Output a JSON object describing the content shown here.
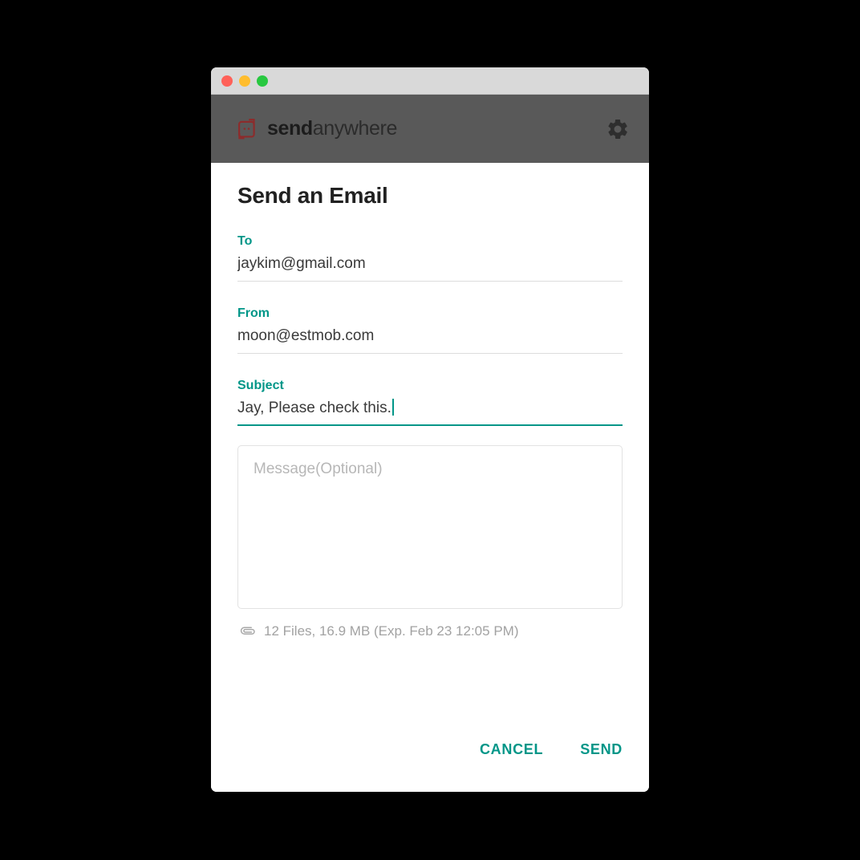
{
  "window": {
    "traffic_lights": [
      {
        "name": "close",
        "color": "#ff6159"
      },
      {
        "name": "minimize",
        "color": "#ffbd2e"
      },
      {
        "name": "maximize",
        "color": "#28c840"
      }
    ]
  },
  "appbar": {
    "brand_icon": "sendanywhere-logo-icon",
    "brand_bold": "send",
    "brand_light": "anywhere",
    "settings_icon": "gear-icon",
    "background": "#595959"
  },
  "main": {
    "title": "Send an Email",
    "accent_color": "#009688",
    "fields": [
      {
        "key": "to",
        "label": "To",
        "value": "jaykim@gmail.com",
        "placeholder": "To",
        "focused": false
      },
      {
        "key": "from",
        "label": "From",
        "value": "moon@estmob.com",
        "placeholder": "From",
        "focused": false
      },
      {
        "key": "subject",
        "label": "Subject",
        "value": "Jay, Please check this.",
        "placeholder": "Subject",
        "focused": true
      }
    ],
    "message": {
      "value": "",
      "placeholder": "Message(Optional)"
    },
    "attachment": {
      "icon": "paperclip-icon",
      "text": "12 Files, 16.9 MB (Exp. Feb 23 12:05 PM)"
    },
    "actions": {
      "cancel_label": "CANCEL",
      "send_label": "SEND"
    }
  }
}
